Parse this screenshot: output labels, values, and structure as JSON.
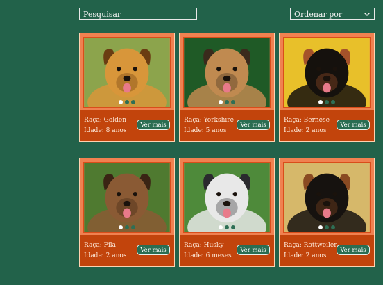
{
  "search": {
    "placeholder": "Pesquisar"
  },
  "sort": {
    "label": "Ordenar por"
  },
  "cards": [
    {
      "breed_line": "Raça: Golden",
      "age_line": "Idade: 8 anos",
      "button": "Ver mais",
      "photo": "golden-retriever-photo",
      "bg": "#8ca44c",
      "fur": "#d8963a",
      "dark": "#6a3c12"
    },
    {
      "breed_line": "Raça: Yorkshire",
      "age_line": "Idade: 5 anos",
      "button": "Ver mais",
      "photo": "yorkshire-terrier-photo",
      "bg": "#1f5a26",
      "fur": "#c08a50",
      "dark": "#3a2a1c"
    },
    {
      "breed_line": "Raça: Bernese",
      "age_line": "Idade: 2 anos",
      "button": "Ver mais",
      "photo": "bernese-mountain-dog-photo",
      "bg": "#e8c02a",
      "fur": "#15110d",
      "dark": "#a5522a"
    },
    {
      "breed_line": "Raça: Fila",
      "age_line": "Idade: 2 anos",
      "button": "Ver mais",
      "photo": "fila-brasileiro-photo",
      "bg": "#4f7a30",
      "fur": "#8a5a34",
      "dark": "#3a2414"
    },
    {
      "breed_line": "Raça: Husky",
      "age_line": "Idade: 6 meses",
      "button": "Ver mais",
      "photo": "husky-puppy-photo",
      "bg": "#4e8a3a",
      "fur": "#e8e8e8",
      "dark": "#2a2a2e"
    },
    {
      "breed_line": "Raça: Rottweiler",
      "age_line": "Idade: 2 anos",
      "button": "Ver mais",
      "photo": "rottweiler-photo",
      "bg": "#d6b86a",
      "fur": "#16120f",
      "dark": "#8a4a22"
    }
  ]
}
